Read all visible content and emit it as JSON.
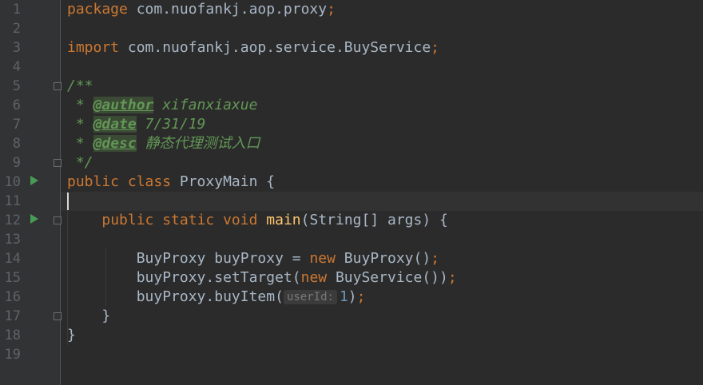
{
  "editor": {
    "line_numbers": [
      "1",
      "2",
      "3",
      "4",
      "5",
      "6",
      "7",
      "8",
      "9",
      "10",
      "11",
      "12",
      "13",
      "14",
      "15",
      "16",
      "17",
      "18",
      "19"
    ],
    "code": {
      "l1_kw": "package",
      "l1_rest": " com.nuofankj.aop.proxy",
      "l1_semi": ";",
      "l3_kw": "import",
      "l3_rest": " com.nuofankj.aop.service.BuyService",
      "l3_semi": ";",
      "l5_doc": "/**",
      "l6_star": " * ",
      "l6_tag": "@author",
      "l6_val": " xifanxiaxue",
      "l7_star": " * ",
      "l7_tag": "@date",
      "l7_val": " 7/31/19",
      "l8_star": " * ",
      "l8_tag": "@desc",
      "l8_val": " 静态代理测试入口",
      "l9_doc": " */",
      "l10_kw": "public class",
      "l10_rest": " ProxyMain {",
      "l12_kw": "public static void",
      "l12_fn": "main",
      "l12_rest": "(String[] args) {",
      "l14_type": "BuyProxy buyProxy = ",
      "l14_kw": "new",
      "l14_rest": " BuyProxy()",
      "l14_semi": ";",
      "l15_a": "buyProxy.setTarget(",
      "l15_kw": "new",
      "l15_b": " BuyService())",
      "l15_semi": ";",
      "l16_a": "buyProxy.buyItem(",
      "l16_hint": "userId:",
      "l16_num": "1",
      "l16_b": ")",
      "l16_semi": ";",
      "l17": "    }",
      "l18": "}"
    }
  }
}
